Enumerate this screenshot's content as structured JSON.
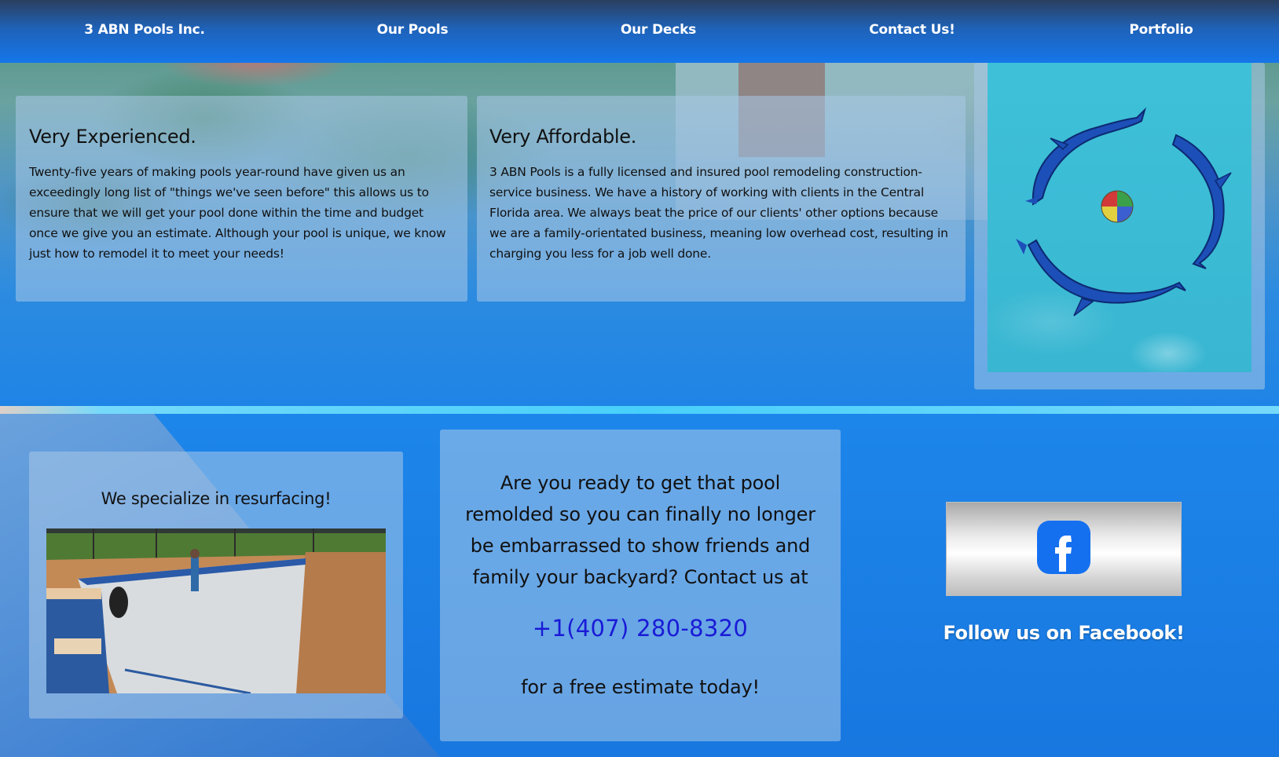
{
  "nav": {
    "brand": "3 ABN Pools Inc.",
    "items": [
      {
        "label": "Our Pools"
      },
      {
        "label": "Our Decks"
      },
      {
        "label": "Contact Us!"
      },
      {
        "label": "Portfolio"
      }
    ]
  },
  "experienced": {
    "heading": "Very Experienced.",
    "body": "Twenty-five years of making pools year-round have given us an exceedingly long list of \"things we've seen before\" this allows us to ensure that we will get your pool done within the time and budget once we give you an estimate. Although your pool is unique, we know just how to remodel it to meet your needs!"
  },
  "affordable": {
    "heading": "Very Affordable.",
    "body": "3 ABN Pools is a fully licensed and insured pool remodeling construction-service business. We have a history of working with clients in the Central Florida area. We always beat the price of our clients' other options because we are a family-orientated business, meaning low overhead cost, resulting in charging you less for a job well done."
  },
  "resurfacing": {
    "caption": "We specialize in resurfacing!"
  },
  "cta": {
    "text": "Are you ready to get that pool remolded so you can finally no longer be embarrassed to show friends and family your backyard? Contact us at",
    "phone": "+1(407) 280-8320",
    "after": "for a free estimate today!"
  },
  "facebook": {
    "icon": "facebook-icon",
    "caption": "Follow us on Facebook!"
  },
  "colors": {
    "nav_top": "#2a3f5e",
    "nav_bottom": "#1576ea",
    "panel": "#aac8e8",
    "phone_link": "#1a1ad6",
    "facebook_blue": "#1570f0"
  }
}
